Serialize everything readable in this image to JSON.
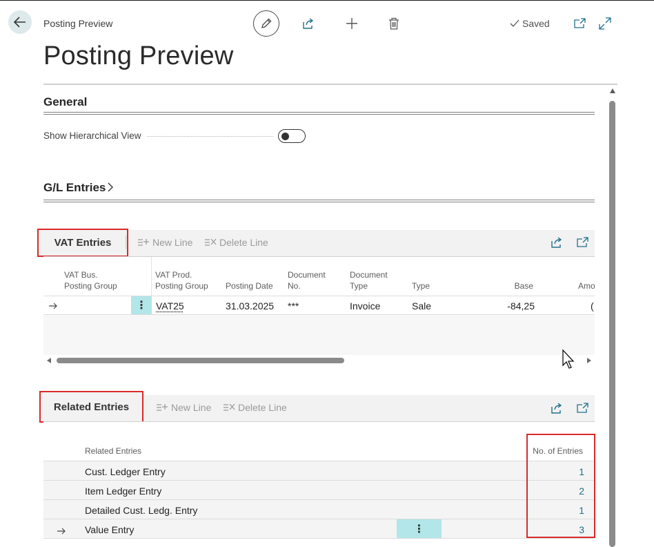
{
  "header": {
    "breadcrumb": "Posting Preview",
    "status": "Saved",
    "title": "Posting Preview"
  },
  "general": {
    "heading": "General",
    "show_hierarchical_label": "Show Hierarchical View",
    "show_hierarchical_value": false
  },
  "gl_entries": {
    "heading": "G/L Entries"
  },
  "vat_entries": {
    "heading": "VAT Entries",
    "new_line": "New Line",
    "delete_line": "Delete Line",
    "columns": {
      "vat_bus_1": "VAT Bus.",
      "vat_bus_2": "Posting Group",
      "vat_prod_1": "VAT Prod.",
      "vat_prod_2": "Posting Group",
      "posting_date": "Posting Date",
      "document_no_1": "Document",
      "document_no_2": "No.",
      "document_type_1": "Document",
      "document_type_2": "Type",
      "type": "Type",
      "base": "Base",
      "amount": "Amo"
    },
    "rows": [
      {
        "vat_bus": "",
        "vat_prod": "VAT25",
        "posting_date": "31.03.2025",
        "document_no": "***",
        "document_type": "Invoice",
        "type": "Sale",
        "base": "-84,25",
        "amount": "("
      }
    ]
  },
  "related_entries": {
    "heading": "Related Entries",
    "new_line": "New Line",
    "delete_line": "Delete Line",
    "columns": {
      "name": "Related Entries",
      "count": "No. of Entries"
    },
    "rows": [
      {
        "name": "Cust. Ledger Entry",
        "count": "1"
      },
      {
        "name": "Item Ledger Entry",
        "count": "2"
      },
      {
        "name": "Detailed Cust. Ledg. Entry",
        "count": "1"
      },
      {
        "name": "Value Entry",
        "count": "3"
      }
    ]
  },
  "icons": {
    "back": "arrow-left-icon",
    "edit": "pencil-icon",
    "share": "share-icon",
    "add": "plus-icon",
    "delete": "trash-icon",
    "saved": "checkmark-icon",
    "open_new": "open-in-new-window-icon",
    "expand": "expand-icon",
    "row_selected": "arrow-right-icon",
    "row_menu": "vertical-ellipsis-icon"
  },
  "colors": {
    "highlight_box": "#d9292b",
    "menu_cell": "#b2e6e8",
    "link": "#1f6f8b"
  }
}
